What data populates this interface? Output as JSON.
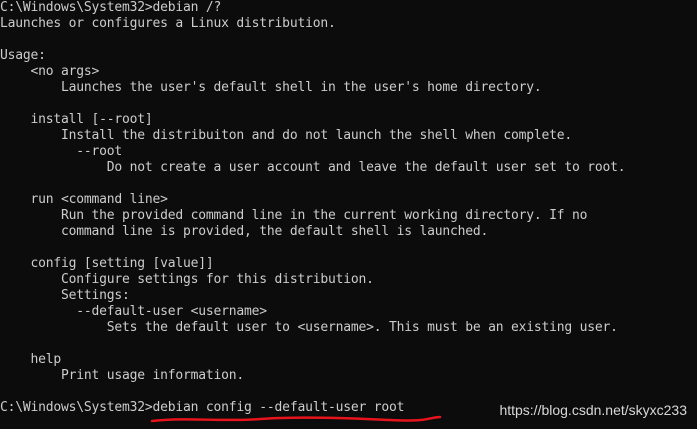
{
  "terminal": {
    "lines": [
      "C:\\Windows\\System32>debian /?",
      "Launches or configures a Linux distribution.",
      "",
      "Usage:",
      "    <no args>",
      "        Launches the user's default shell in the user's home directory.",
      "",
      "    install [--root]",
      "        Install the distribuiton and do not launch the shell when complete.",
      "          --root",
      "              Do not create a user account and leave the default user set to root.",
      "",
      "    run <command line>",
      "        Run the provided command line in the current working directory. If no",
      "        command line is provided, the default shell is launched.",
      "",
      "    config [setting [value]]",
      "        Configure settings for this distribution.",
      "        Settings:",
      "          --default-user <username>",
      "              Sets the default user to <username>. This must be an existing user.",
      "",
      "    help",
      "        Print usage information.",
      "",
      "C:\\Windows\\System32>debian config --default-user root"
    ]
  },
  "annotation": {
    "underline_color": "#e8141b"
  },
  "watermark": {
    "text": "https://blog.csdn.net/skyxc233"
  }
}
